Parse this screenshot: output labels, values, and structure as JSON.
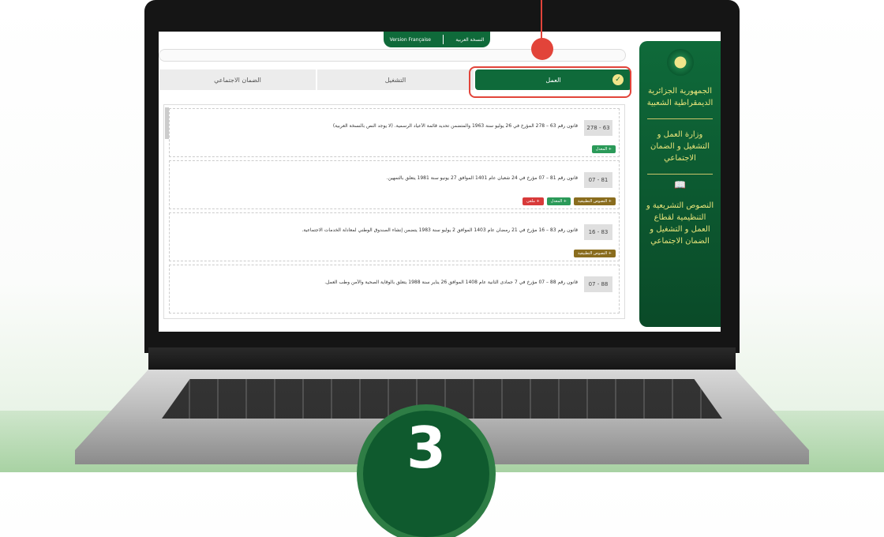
{
  "language_switch": {
    "french": "Version Française",
    "arabic": "النسخة العربية"
  },
  "sidebar": {
    "country": "الجمهورية الجزائرية الديمقراطية الشعبية",
    "ministry": "وزارة العمل و التشغيل و الضمان الاجتماعي",
    "section": "النصوص التشريعية و التنظيمية لقطاع العمل و التشغيل و الضمان الاجتماعي"
  },
  "tabs": [
    {
      "label": "العمل",
      "active": true
    },
    {
      "label": "التشغيل",
      "active": false
    },
    {
      "label": "الضمان الاجتماعي",
      "active": false
    }
  ],
  "laws": [
    {
      "num": "278 - 63",
      "text": "قانون رقم 63 – 278 المؤرخ في 26 يوليو سنة 1963 والمتضمن تحديد قائمة الأعياد الرسمية. (لا يوجد النص بالنسخة العربية)",
      "actions": [
        "+ المعدل"
      ]
    },
    {
      "num": "07 - 81",
      "text": "قانون رقم 81 – 07 مؤرخ في 24 شعبان عام 1401 الموافق 27 يونيو سنة 1981 يتعلق بالتمهين.",
      "actions": [
        "+ النصوص التطبيقية",
        "+ المعدل",
        "+ ملغى"
      ]
    },
    {
      "num": "16 - 83",
      "text": "قانون رقم 83 – 16 مؤرخ في 21 رمضان عام 1403 الموافق 2 يوليو سنة 1983 يتضمن إنشاء الصندوق الوطني لمعادلة الخدمات الاجتماعية.",
      "actions": [
        "+ النصوص التطبيقية"
      ]
    },
    {
      "num": "07 - 88",
      "text": "قانون رقم 88 – 07 مؤرخ في 7 جمادى الثانية عام 1408 الموافق 26 يناير سنة 1988 يتعلق بالوقاية الصحية والأمن وطب العمل.",
      "actions": []
    }
  ],
  "step_number": "3",
  "colors": {
    "primary": "#0f6a3a",
    "accent": "#e2443a",
    "gold": "#f0e58a"
  }
}
